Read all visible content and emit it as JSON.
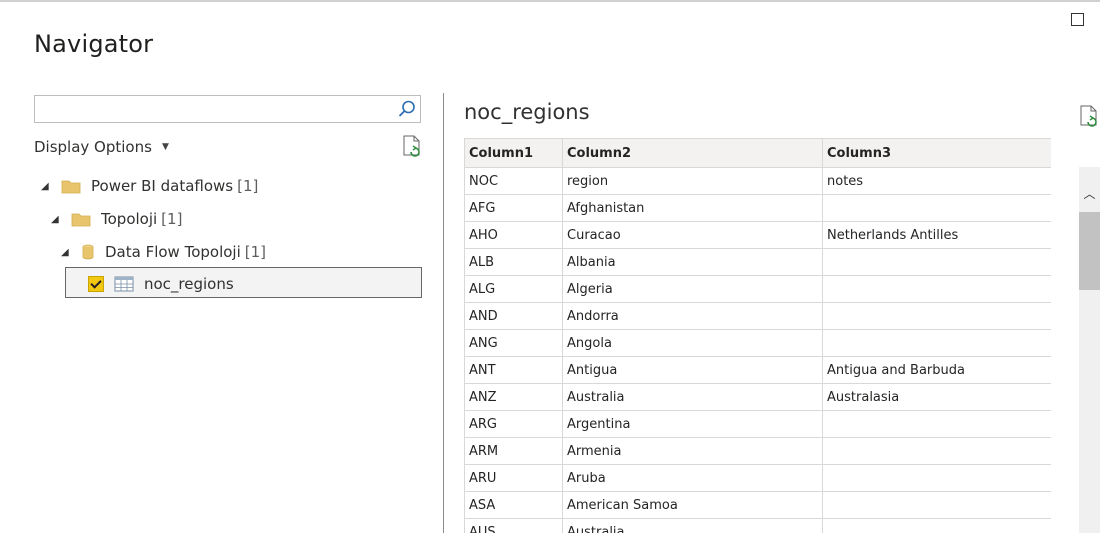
{
  "window": {
    "title": "Navigator"
  },
  "search": {
    "value": "",
    "placeholder": ""
  },
  "display_options": {
    "label": "Display Options"
  },
  "tree": {
    "items": [
      {
        "label": "Power BI dataflows",
        "count": "[1]"
      },
      {
        "label": "Topoloji",
        "count": "[1]"
      },
      {
        "label": "Data Flow Topoloji",
        "count": "[1]"
      },
      {
        "label": "noc_regions",
        "checked": true
      }
    ]
  },
  "preview": {
    "title": "noc_regions",
    "columns": [
      "Column1",
      "Column2",
      "Column3"
    ],
    "rows": [
      [
        "NOC",
        "region",
        "notes"
      ],
      [
        "AFG",
        "Afghanistan",
        ""
      ],
      [
        "AHO",
        "Curacao",
        "Netherlands Antilles"
      ],
      [
        "ALB",
        "Albania",
        ""
      ],
      [
        "ALG",
        "Algeria",
        ""
      ],
      [
        "AND",
        "Andorra",
        ""
      ],
      [
        "ANG",
        "Angola",
        ""
      ],
      [
        "ANT",
        "Antigua",
        "Antigua and Barbuda"
      ],
      [
        "ANZ",
        "Australia",
        "Australasia"
      ],
      [
        "ARG",
        "Argentina",
        ""
      ],
      [
        "ARM",
        "Armenia",
        ""
      ],
      [
        "ARU",
        "Aruba",
        ""
      ],
      [
        "ASA",
        "American Samoa",
        ""
      ],
      [
        "AUS",
        "Australia",
        ""
      ]
    ]
  },
  "colors": {
    "accent_check": "#f2c811",
    "folder": "#e8c56d"
  }
}
